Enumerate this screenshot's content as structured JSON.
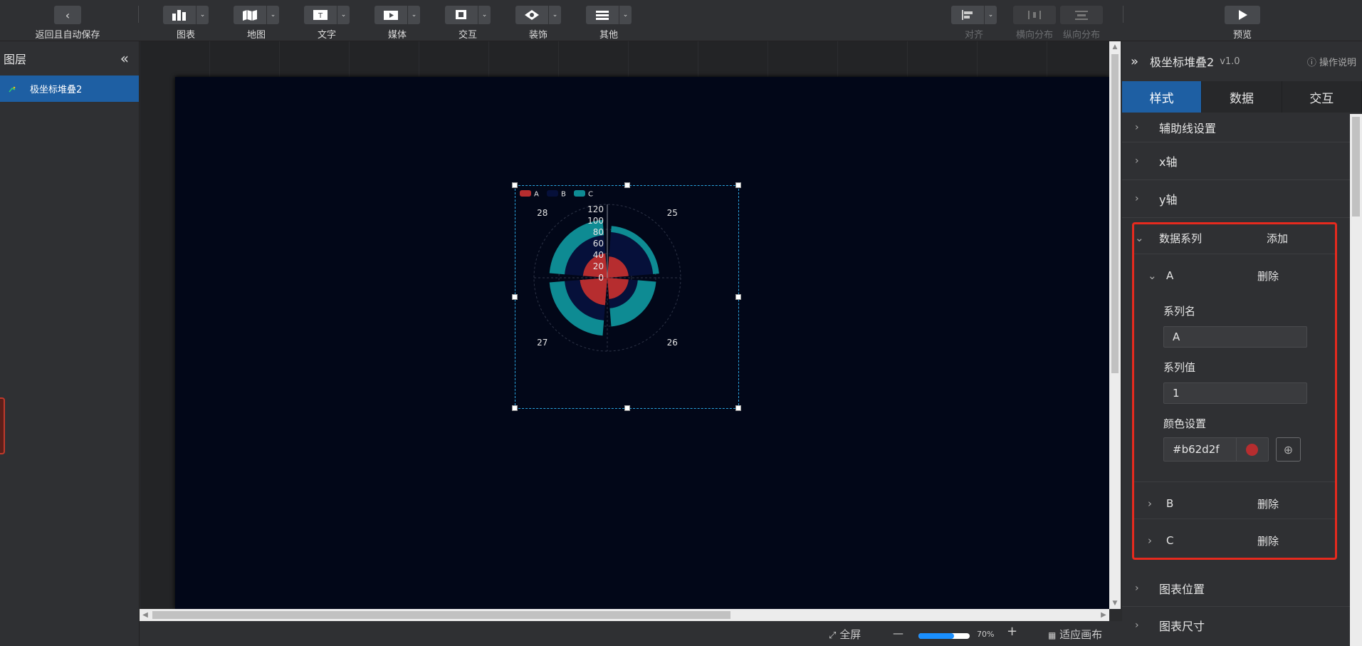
{
  "toolbar": {
    "back_label": "返回且自动保存",
    "groups": [
      {
        "label": "图表",
        "icon": "bar-chart-icon"
      },
      {
        "label": "地图",
        "icon": "map-icon"
      },
      {
        "label": "文字",
        "icon": "text-icon"
      },
      {
        "label": "媒体",
        "icon": "media-icon"
      },
      {
        "label": "交互",
        "icon": "interaction-icon"
      },
      {
        "label": "装饰",
        "icon": "decoration-icon"
      },
      {
        "label": "其他",
        "icon": "more-icon"
      }
    ],
    "align_label": "对齐",
    "hdist_label": "横向分布",
    "vdist_label": "纵向分布",
    "preview_label": "预览"
  },
  "layers": {
    "title": "图层",
    "items": [
      {
        "label": "极坐标堆叠2",
        "selected": true
      }
    ]
  },
  "bottom": {
    "fullscreen_label": "全屏",
    "zoom_minus": "—",
    "zoom_value": "70%",
    "zoom_fraction": 0.7,
    "zoom_plus": "+",
    "fit_label": "适应画布"
  },
  "panel": {
    "title": "极坐标堆叠2",
    "version": "v1.0",
    "help_label": "操作说明",
    "tabs": [
      "样式",
      "数据",
      "交互"
    ],
    "active_tab": "样式",
    "sections_top": [
      "辅助线设置",
      "x轴",
      "y轴"
    ],
    "series_section": {
      "title": "数据系列",
      "add_label": "添加",
      "delete_label": "删除",
      "series_a": {
        "name": "A",
        "name_field_label": "系列名",
        "name_value": "A",
        "value_field_label": "系列值",
        "value": "1",
        "color_field_label": "颜色设置",
        "color_hex": "#b62d2f"
      },
      "series_b": "B",
      "series_c": "C"
    },
    "sections_bottom": [
      "图表位置",
      "图表尺寸"
    ]
  },
  "chart_data": {
    "type": "polar-stacked-bar",
    "categories": [
      "25",
      "26",
      "27",
      "28"
    ],
    "series": [
      {
        "name": "A",
        "color": "#b62d2f",
        "values": [
          35,
          35,
          45,
          40
        ]
      },
      {
        "name": "B",
        "color": "#06103a",
        "values": [
          40,
          15,
          25,
          30
        ]
      },
      {
        "name": "C",
        "color": "#0e8b93",
        "values": [
          10,
          30,
          25,
          25
        ]
      }
    ],
    "radial_ticks": [
      "0",
      "20",
      "40",
      "60",
      "80",
      "100",
      "120"
    ],
    "rlim": [
      0,
      120
    ],
    "legend": "top-left"
  }
}
